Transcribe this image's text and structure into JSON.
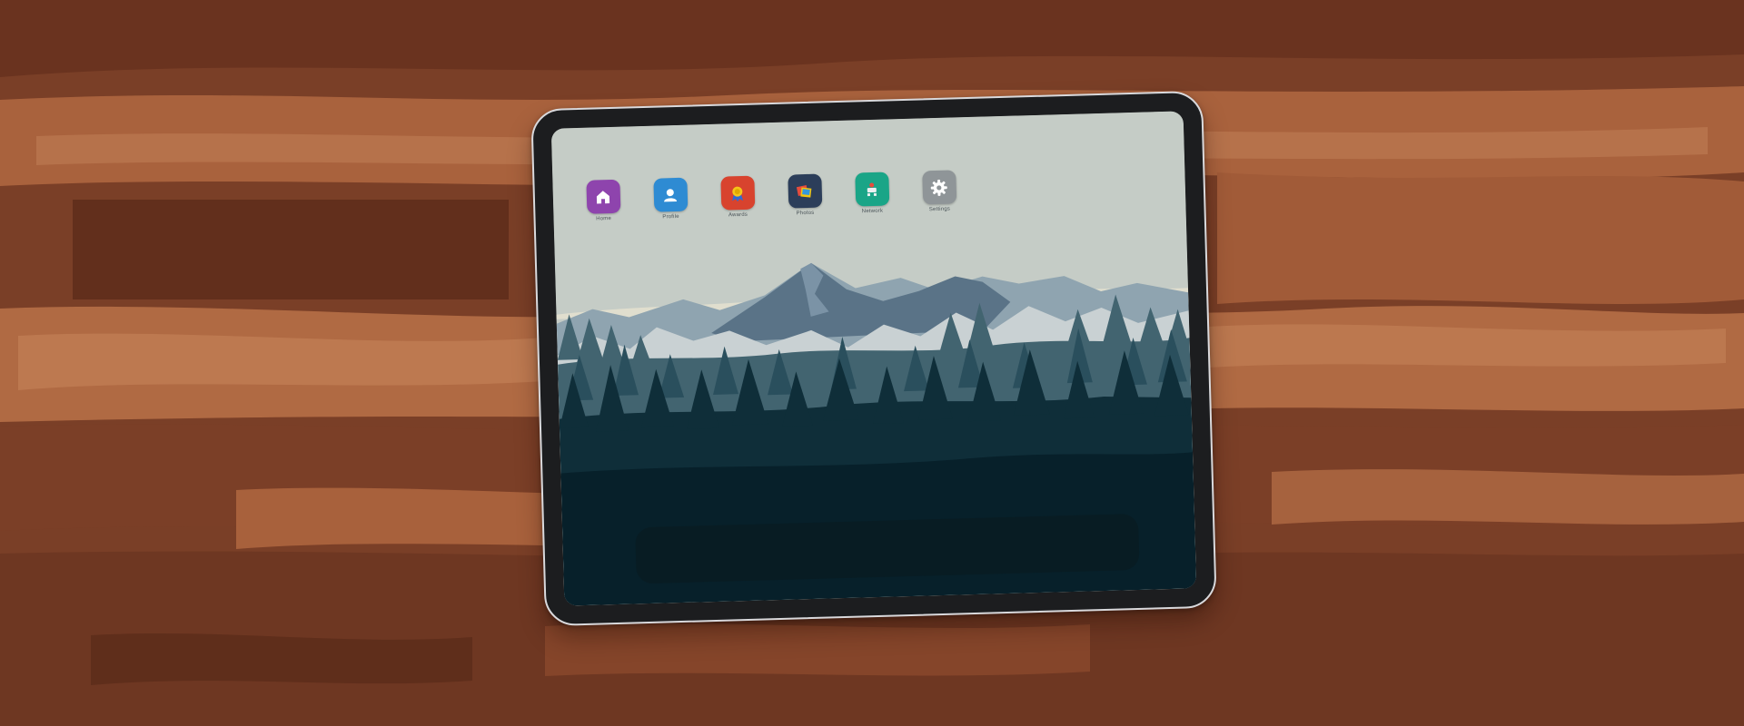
{
  "desk": {
    "wood_base": "#7a3f27",
    "wood_light": "#b56e48",
    "wood_dark": "#5e2d1b"
  },
  "tablet": {
    "bezel_color": "#1c1d1f",
    "frame_color": "#d9d9dc"
  },
  "wallpaper": {
    "sky": "#c5ccc6",
    "far_mountains": "#8fa4b0",
    "peak": "#5a7387",
    "forest_mid": "#426470",
    "forest_dark": "#0f2e39",
    "ground": "#07202a"
  },
  "apps": [
    {
      "label": "Home",
      "icon": "house-icon",
      "color": "#8e44ad"
    },
    {
      "label": "Profile",
      "icon": "person-icon",
      "color": "#2e8bd3"
    },
    {
      "label": "Awards",
      "icon": "ribbon-award-icon",
      "color": "#d8432e"
    },
    {
      "label": "Photos",
      "icon": "photos-icon",
      "color": "#2c3e5a"
    },
    {
      "label": "Network",
      "icon": "network-icon",
      "color": "#1aa587"
    },
    {
      "label": "Settings",
      "icon": "gear-icon",
      "color": "#8f9598"
    }
  ]
}
